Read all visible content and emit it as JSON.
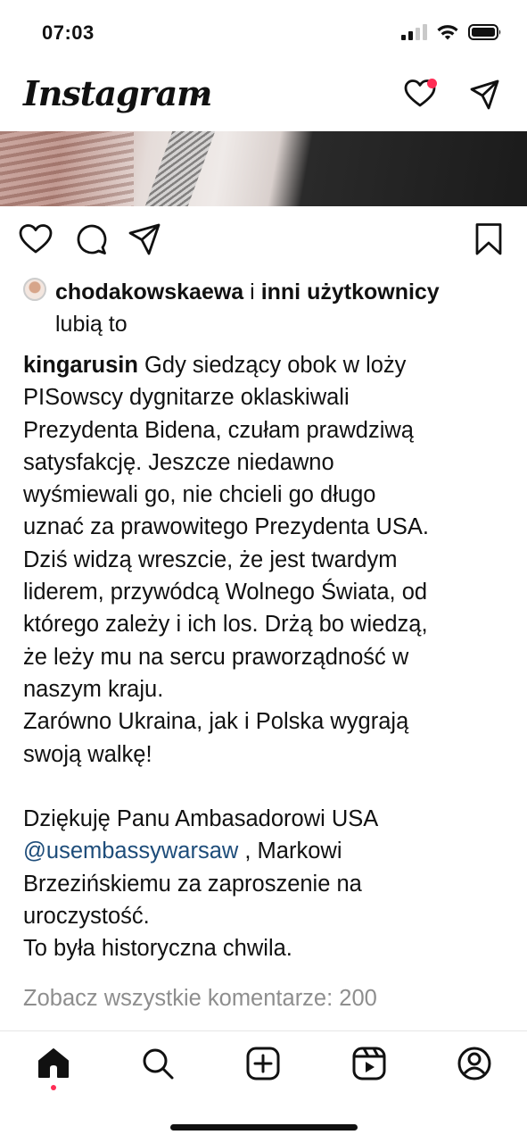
{
  "status_bar": {
    "time": "07:03"
  },
  "header": {
    "logo": "Instagram"
  },
  "likes": {
    "user": "chodakowskaewa",
    "connector": "i",
    "others": "inni użytkownicy",
    "suffix": "lubią to"
  },
  "caption": {
    "author": "kingarusin",
    "lines": [
      "Gdy siedzący obok w loży",
      "PISowscy dygnitarze oklaskiwali",
      "Prezydenta Bidena, czułam prawdziwą",
      "satysfakcję. Jeszcze niedawno",
      "wyśmiewali go, nie chcieli  go długo",
      "uznać za prawowitego Prezydenta USA.",
      "Dziś widzą wreszcie, że jest twardym",
      "liderem, przywódcą Wolnego Świata, od",
      "którego zależy i ich los. Drżą bo wiedzą,",
      "że leży mu na sercu praworządność w",
      "naszym kraju.",
      "Zarówno Ukraina, jak i Polska wygrają",
      "swoją walkę!",
      "",
      "Dziękuję Panu Ambasadorowi USA",
      "",
      "Brzezińskiemu za zaproszenie na",
      "uroczystość.",
      "To była historyczna chwila."
    ],
    "mention": "@usembassywarsaw",
    "mention_suffix": " , Markowi"
  },
  "comments_link": "Zobacz wszystkie komentarze: 200",
  "icons": {
    "header": [
      "instagram-logo",
      "chevron-down-icon",
      "heart-icon",
      "send-icon"
    ],
    "post_actions": [
      "heart-icon",
      "comment-icon",
      "share-icon",
      "bookmark-icon"
    ],
    "nav": [
      "home-icon",
      "search-icon",
      "create-icon",
      "reels-icon",
      "profile-icon"
    ]
  },
  "colors": {
    "notification": "#ff2d55",
    "mention": "#1e4d7a",
    "muted": "#8e8e8e"
  }
}
